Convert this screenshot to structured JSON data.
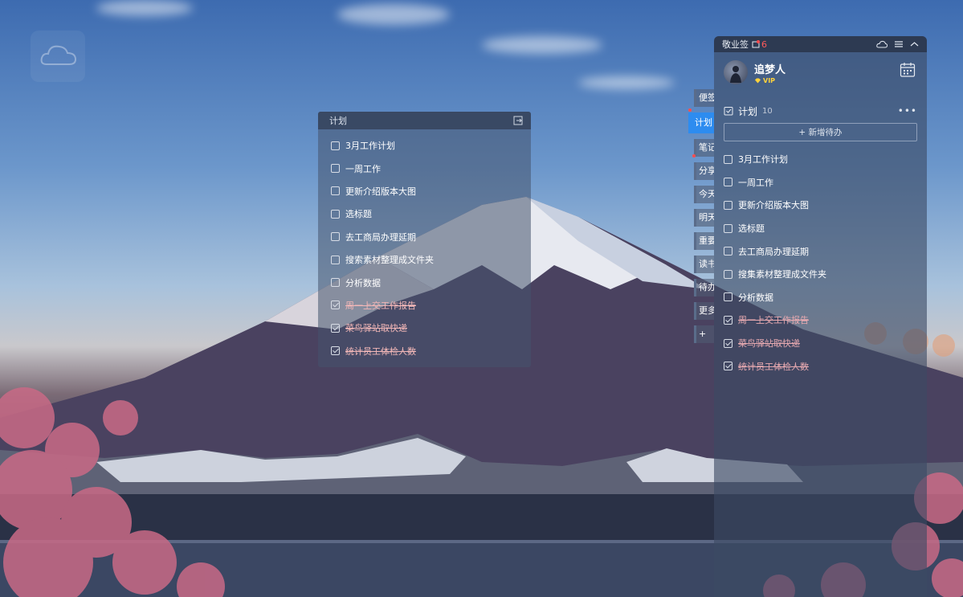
{
  "plan_widget": {
    "title": "计划",
    "items": [
      {
        "text": "3月工作计划",
        "done": false
      },
      {
        "text": "一周工作",
        "done": false
      },
      {
        "text": "更新介绍版本大图",
        "done": false
      },
      {
        "text": "选标题",
        "done": false
      },
      {
        "text": "去工商局办理延期",
        "done": false
      },
      {
        "text": "搜索素材整理成文件夹",
        "done": false
      },
      {
        "text": "分析数据",
        "done": false
      },
      {
        "text": "周一上交工作报告",
        "done": true
      },
      {
        "text": "菜鸟驿站取快递",
        "done": true
      },
      {
        "text": "统计员工体检人数",
        "done": true
      }
    ]
  },
  "side_tabs": [
    {
      "label": "便签"
    },
    {
      "label": "计划",
      "active": true
    },
    {
      "label": "笔记"
    },
    {
      "label": "分享"
    },
    {
      "label": "今天"
    },
    {
      "label": "明天"
    },
    {
      "label": "重要"
    },
    {
      "label": "读书"
    },
    {
      "label": "待办"
    },
    {
      "label": "更多"
    },
    {
      "label": "+"
    }
  ],
  "panel": {
    "app_name": "敬业签",
    "notification_count": "6",
    "user": {
      "name": "追梦人",
      "badge": "VIP"
    },
    "section": {
      "title": "计划",
      "count": "10",
      "more": "•••"
    },
    "add_button": "+ 新增待办",
    "items": [
      {
        "text": "3月工作计划",
        "done": false
      },
      {
        "text": "一周工作",
        "done": false
      },
      {
        "text": "更新介绍版本大图",
        "done": false
      },
      {
        "text": "选标题",
        "done": false
      },
      {
        "text": "去工商局办理延期",
        "done": false
      },
      {
        "text": "搜集素材整理成文件夹",
        "done": false
      },
      {
        "text": "分析数据",
        "done": false
      },
      {
        "text": "周一上交工作报告",
        "done": true
      },
      {
        "text": "菜鸟驿站取快递",
        "done": true
      },
      {
        "text": "统计员工体检人数",
        "done": true
      }
    ]
  }
}
